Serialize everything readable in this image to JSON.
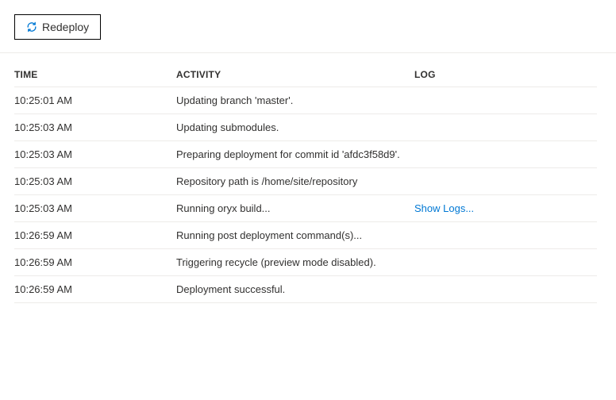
{
  "toolbar": {
    "redeploy_label": "Redeploy"
  },
  "table": {
    "headers": {
      "time": "TIME",
      "activity": "ACTIVITY",
      "log": "LOG"
    },
    "rows": [
      {
        "time": "10:25:01 AM",
        "activity": "Updating branch 'master'.",
        "log": ""
      },
      {
        "time": "10:25:03 AM",
        "activity": "Updating submodules.",
        "log": ""
      },
      {
        "time": "10:25:03 AM",
        "activity": "Preparing deployment for commit id 'afdc3f58d9'.",
        "log": ""
      },
      {
        "time": "10:25:03 AM",
        "activity": "Repository path is /home/site/repository",
        "log": ""
      },
      {
        "time": "10:25:03 AM",
        "activity": "Running oryx build...",
        "log": "Show Logs..."
      },
      {
        "time": "10:26:59 AM",
        "activity": "Running post deployment command(s)...",
        "log": ""
      },
      {
        "time": "10:26:59 AM",
        "activity": "Triggering recycle (preview mode disabled).",
        "log": ""
      },
      {
        "time": "10:26:59 AM",
        "activity": "Deployment successful.",
        "log": ""
      }
    ]
  }
}
